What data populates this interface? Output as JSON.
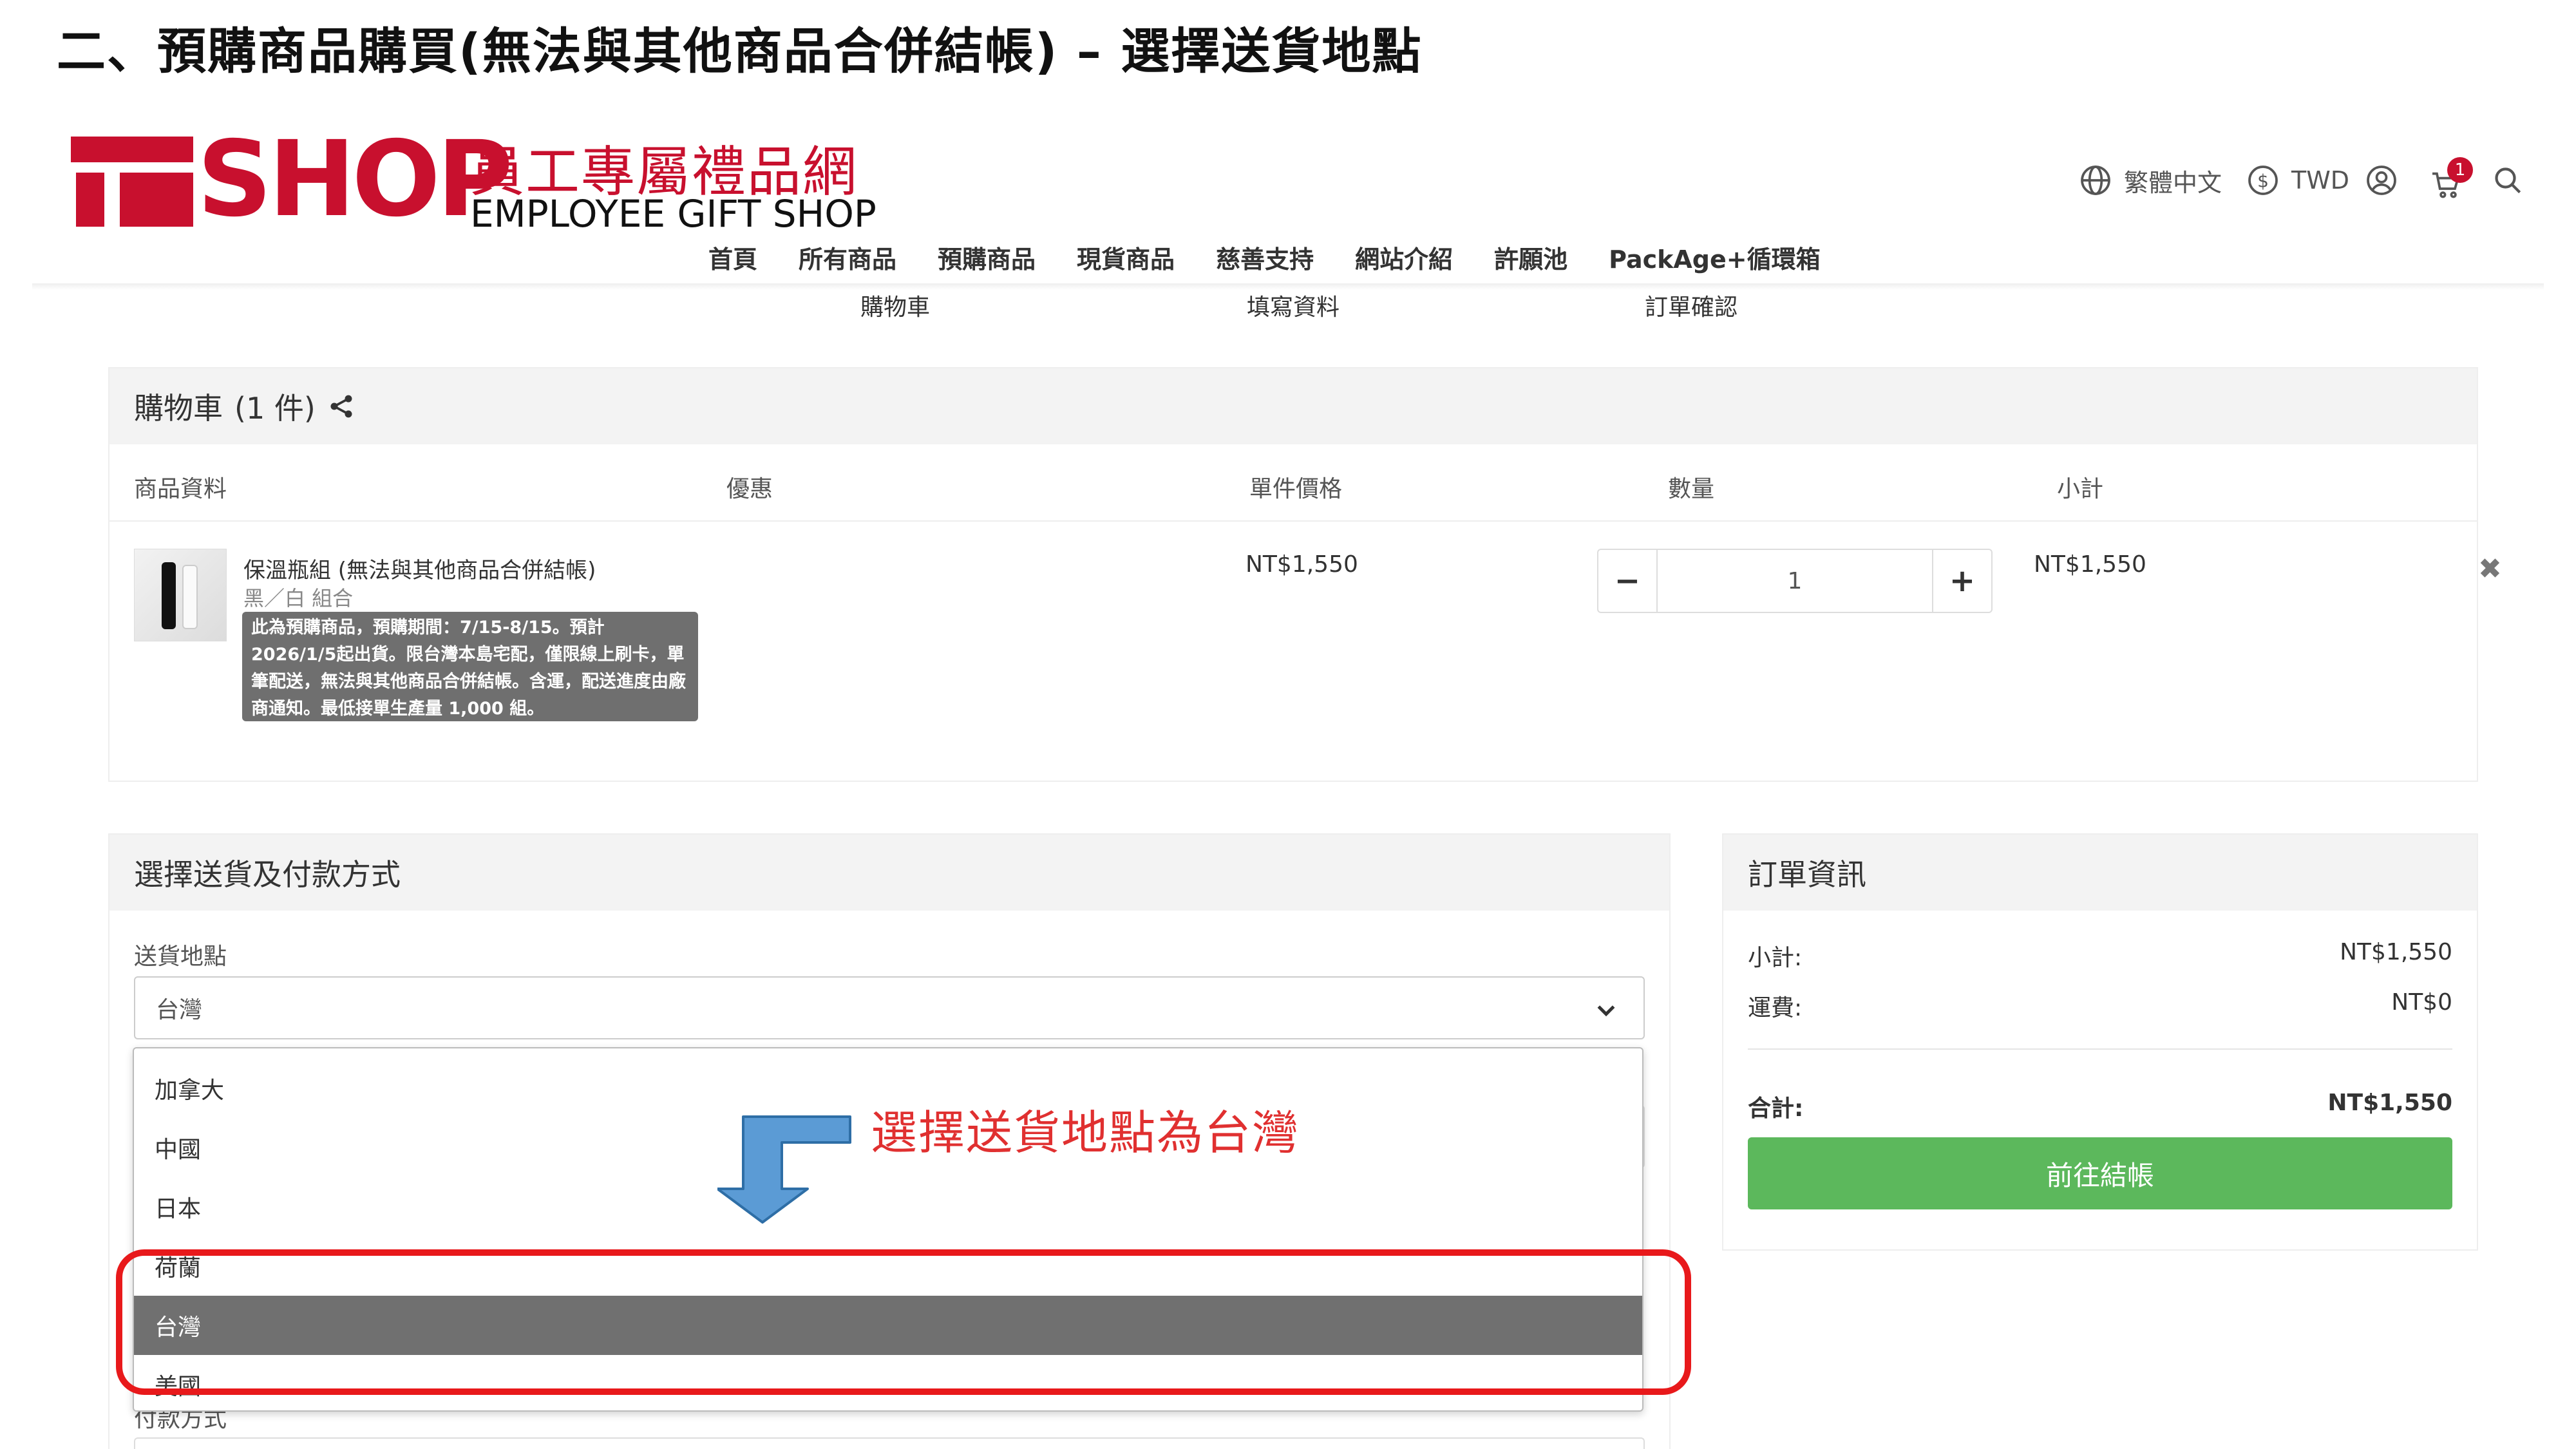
{
  "doc_title": "二、預購商品購買(無法與其他商品合併結帳) – 選擇送貨地點",
  "brand": {
    "wordmark": "SHOP",
    "name_zh": "員工專屬禮品網",
    "name_en": "EMPLOYEE GIFT SHOP",
    "accent_color": "#c8102e"
  },
  "utility": {
    "language": "繁體中文",
    "currency": "TWD",
    "cart_count": "1",
    "icons": [
      "globe-icon",
      "dollar-circle-icon",
      "user-icon",
      "cart-icon",
      "search-icon"
    ]
  },
  "nav": [
    "首頁",
    "所有商品",
    "預購商品",
    "現貨商品",
    "慈善支持",
    "網站介紹",
    "許願池",
    "PackAge+循環箱"
  ],
  "steps": [
    "購物車",
    "填寫資料",
    "訂單確認"
  ],
  "cart": {
    "title": "購物車",
    "count_label": "(1 件)",
    "columns": [
      "商品資料",
      "優惠",
      "單件價格",
      "數量",
      "小計"
    ],
    "item": {
      "name": "保溫瓶組 (無法與其他商品合併結帳)",
      "variant": "黑／白 組合",
      "note": "此為預購商品，預購期間：7/15-8/15。預計2026/1/5起出貨。限台灣本島宅配，僅限線上刷卡，單筆配送，無法與其他商品合併結帳。含運，配送進度由廠商通知。最低接單生產量 1,000 組。",
      "unit_price": "NT$1,550",
      "quantity": "1",
      "subtotal": "NT$1,550"
    }
  },
  "shipping": {
    "title": "選擇送貨及付款方式",
    "location_label": "送貨地點",
    "location_value": "台灣",
    "payment_label": "付款方式",
    "options": [
      "加拿大",
      "中國",
      "日本",
      "荷蘭",
      "台灣",
      "美國"
    ],
    "selected_option": "台灣"
  },
  "order": {
    "title": "訂單資訊",
    "subtotal_label": "小計:",
    "subtotal_value": "NT$1,550",
    "shipping_label": "運費:",
    "shipping_value": "NT$0",
    "total_label": "合計:",
    "total_value": "NT$1,550",
    "checkout_label": "前往結帳",
    "checkout_color": "#5cb85c"
  },
  "annotation": {
    "text": "選擇送貨地點為台灣",
    "color": "#e8191b"
  }
}
